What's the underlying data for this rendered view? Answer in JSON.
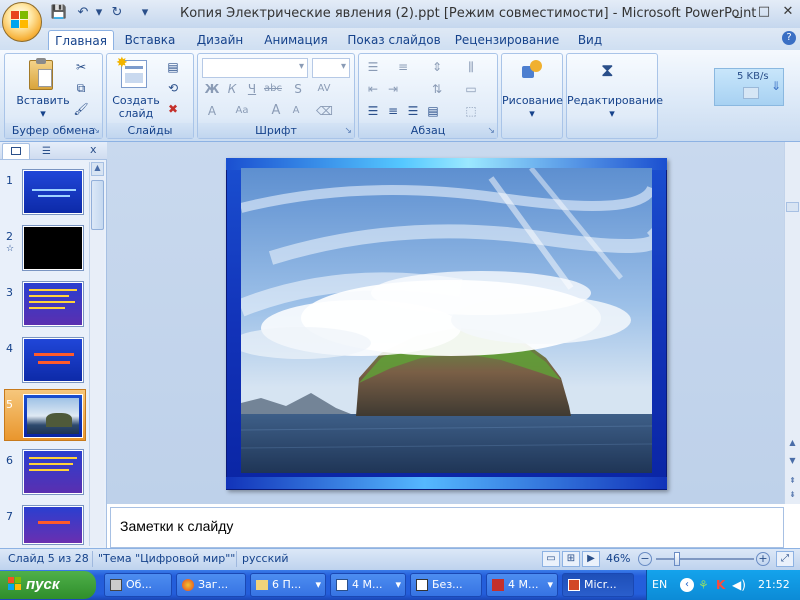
{
  "window": {
    "title": "Копия Электрические явления (2).ppt [Режим совместимости] - Microsoft PowerPoint",
    "controls": [
      "_",
      "□",
      "✕"
    ]
  },
  "quick_access": [
    "save-icon",
    "undo-icon",
    "redo-icon",
    "customize-icon"
  ],
  "tabs": [
    {
      "label": "Главная",
      "active": true
    },
    {
      "label": "Вставка"
    },
    {
      "label": "Дизайн"
    },
    {
      "label": "Анимация"
    },
    {
      "label": "Показ слайдов"
    },
    {
      "label": "Рецензирование"
    },
    {
      "label": "Вид"
    }
  ],
  "ribbon": {
    "clipboard": {
      "label": "Буфер обмена",
      "paste": "Вставить"
    },
    "slides": {
      "label": "Слайды",
      "new_slide_line1": "Создать",
      "new_slide_line2": "слайд"
    },
    "font": {
      "label": "Шрифт",
      "bold": "Ж",
      "italic": "К",
      "underline": "Ч",
      "strike": "abc",
      "shadow": "S",
      "spacing": "AV",
      "size_up": "A",
      "size_down": "A",
      "case": "Aa"
    },
    "paragraph": {
      "label": "Абзац"
    },
    "drawing": {
      "label": "Рисование"
    },
    "editing": {
      "label": "Редактирование"
    }
  },
  "speed_widget": {
    "rate": "5 KB/s"
  },
  "slide_pane": {
    "selected": 5,
    "thumbnails": [
      {
        "num": "1"
      },
      {
        "num": "2",
        "extra": "☆"
      },
      {
        "num": "3"
      },
      {
        "num": "4"
      },
      {
        "num": "5"
      },
      {
        "num": "6"
      },
      {
        "num": "7"
      }
    ]
  },
  "notes": {
    "placeholder": "Заметки к слайду"
  },
  "status": {
    "slide": "Слайд 5 из 28",
    "theme": "\"Тема \"Цифровой мир\"\"",
    "language": "русский",
    "zoom": "46%"
  },
  "taskbar": {
    "start": "пуск",
    "tasks": [
      {
        "label": "Об..."
      },
      {
        "label": "Заг..."
      },
      {
        "label": "6 П..."
      },
      {
        "label": "4 М..."
      },
      {
        "label": "Без..."
      },
      {
        "label": "4 М..."
      },
      {
        "label": "Micr...",
        "active": true
      }
    ],
    "lang": "EN",
    "clock": "21:52"
  }
}
